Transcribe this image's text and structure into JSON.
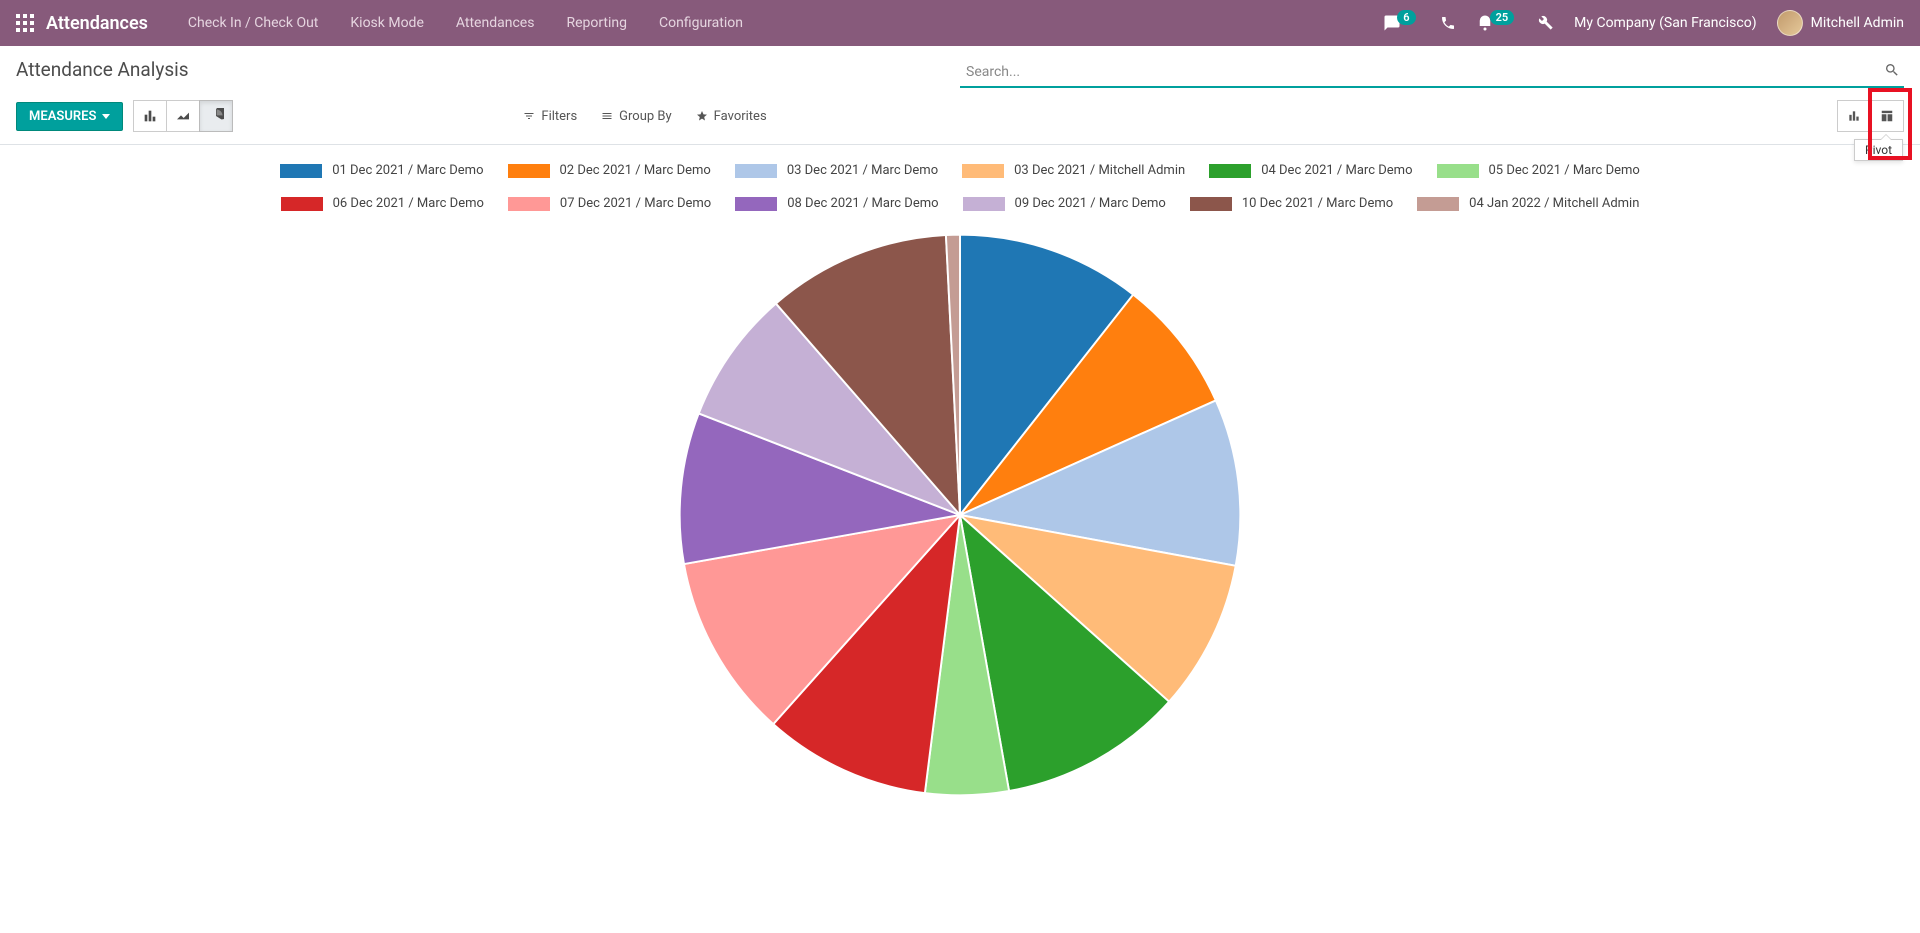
{
  "header": {
    "brand": "Attendances",
    "nav_links": [
      "Check In / Check Out",
      "Kiosk Mode",
      "Attendances",
      "Reporting",
      "Configuration"
    ],
    "badge_messages": "6",
    "badge_activities": "25",
    "company": "My Company (San Francisco)",
    "user": "Mitchell Admin"
  },
  "control_panel": {
    "title": "Attendance Analysis",
    "search_placeholder": "Search...",
    "measures_btn": "Measures",
    "filters_label": "Filters",
    "groupby_label": "Group By",
    "favorites_label": "Favorites",
    "tooltip_pivot": "Pivot"
  },
  "chart_data": {
    "type": "pie",
    "title": "",
    "series": [
      {
        "name": "01 Dec 2021 / Marc Demo",
        "value": 10.6,
        "color": "#1f77b4"
      },
      {
        "name": "02 Dec 2021 / Marc Demo",
        "value": 7.7,
        "color": "#ff7f0e"
      },
      {
        "name": "03 Dec 2021 / Marc Demo",
        "value": 9.6,
        "color": "#aec7e8"
      },
      {
        "name": "03 Dec 2021 / Mitchell Admin",
        "value": 8.7,
        "color": "#ffbb78"
      },
      {
        "name": "04 Dec 2021 / Marc Demo",
        "value": 10.6,
        "color": "#2ca02c"
      },
      {
        "name": "05 Dec 2021 / Marc Demo",
        "value": 4.8,
        "color": "#98df8a"
      },
      {
        "name": "06 Dec 2021 / Marc Demo",
        "value": 9.6,
        "color": "#d62728"
      },
      {
        "name": "07 Dec 2021 / Marc Demo",
        "value": 10.6,
        "color": "#ff9896"
      },
      {
        "name": "08 Dec 2021 / Marc Demo",
        "value": 8.7,
        "color": "#9467bd"
      },
      {
        "name": "09 Dec 2021 / Marc Demo",
        "value": 7.7,
        "color": "#c5b0d5"
      },
      {
        "name": "10 Dec 2021 / Marc Demo",
        "value": 10.6,
        "color": "#8c564b"
      },
      {
        "name": "04 Jan 2022 / Mitchell Admin",
        "value": 0.8,
        "color": "#c49c94"
      }
    ]
  }
}
